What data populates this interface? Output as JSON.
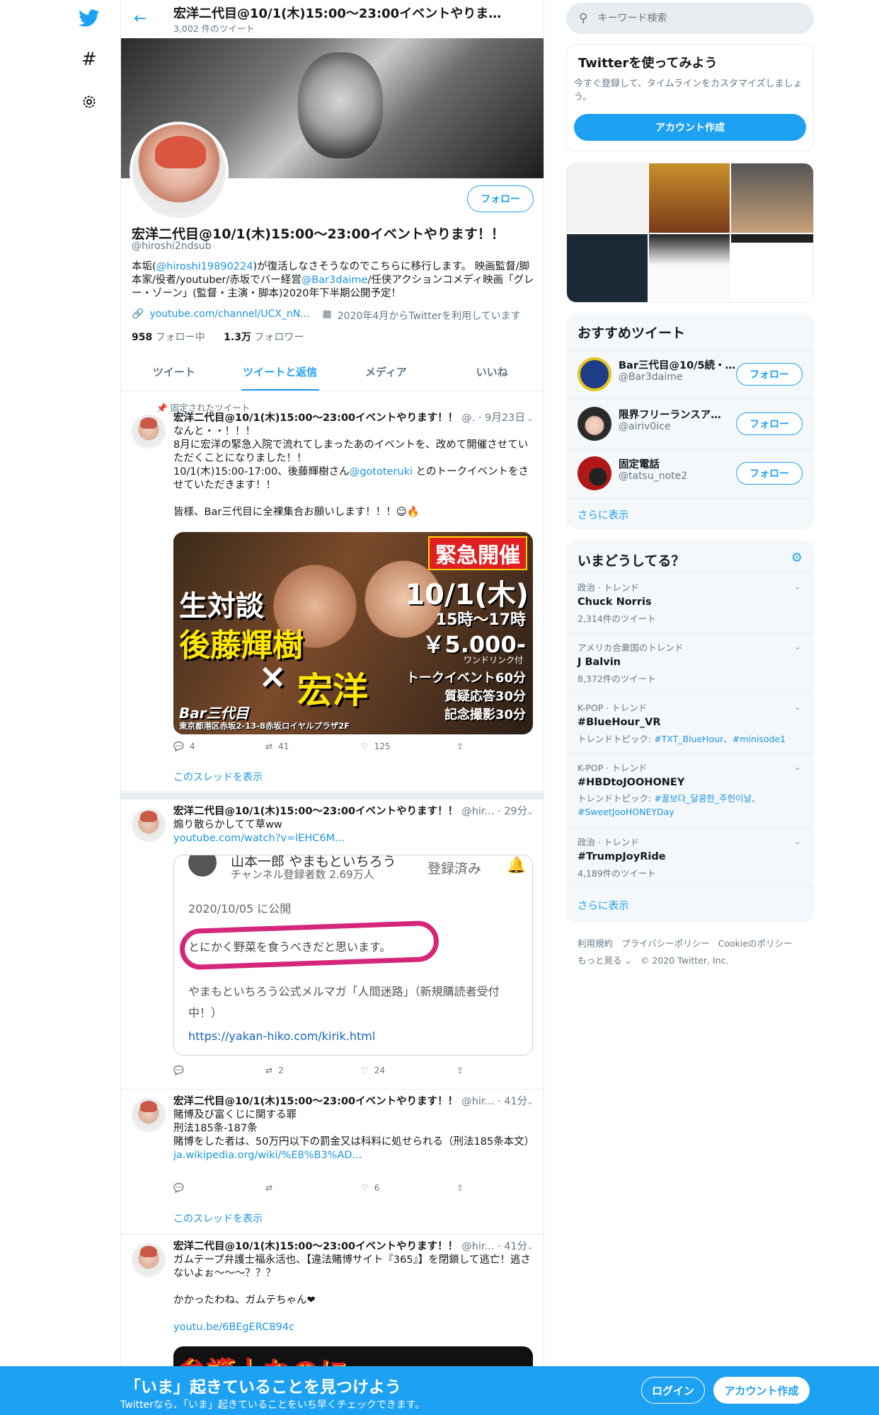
{
  "header": {
    "title": "宏洋二代目@10/1(木)15:00〜23:00イベントやりま…",
    "subtitle": "3,002 件のツイート"
  },
  "profile": {
    "name": "宏洋二代目@10/1(木)15:00〜23:00イベントやります！！",
    "handle": "@hiroshi2ndsub",
    "follow_label": "フォロー",
    "bio_1": "本垢(",
    "bio_link1": "@hiroshi19890224",
    "bio_2": ")が復活しなさそうなのでこちらに移行します。 映画監督/脚本家/役者/youtuber/赤坂でバー経営",
    "bio_link2": "@Bar3daime",
    "bio_3": "/任侠アクションコメディ映画「グレー・ゾーン」(監督・主演・脚本)2020年下半期公開予定！",
    "url": "youtube.com/channel/UCX_nN...",
    "joined": "2020年4月からTwitterを利用しています",
    "following_count": "958",
    "following_label": "フォロー中",
    "followers_count": "1.3万",
    "followers_label": "フォロワー"
  },
  "tabs": [
    "ツイート",
    "ツイートと返信",
    "メディア",
    "いいね"
  ],
  "tweets": [
    {
      "pinned": "固定されたツイート",
      "name": "宏洋二代目@10/1(木)15:00〜23:00イベントやります！！",
      "meta": "@. · 9月23日",
      "l1": "なんと・・！！！",
      "l2": "8月に宏洋の緊急入院で流れてしまったあのイベントを、改めて開催させていただくことになりました！！",
      "l3a": "10/1(木)15:00-17:00、後藤輝樹さん",
      "l3link": "@gototeruki",
      "l3b": " とのトークイベントをさせていただきます！！",
      "l4": "皆様、Bar三代目に全裸集合お願いします！！！☺🔥",
      "img": {
        "badge": "緊急開催",
        "date": "10/1(木)",
        "time": "15時〜17時",
        "price": "￥5.000-",
        "price_sub": "ワンドリンク付",
        "big1": "生対談",
        "big2": "後藤輝樹",
        "cross": "×",
        "big3": "宏洋",
        "r1": "トークイベント60分",
        "r2": "質疑応答30分",
        "r3": "記念撮影30分",
        "bar": "Bar三代目",
        "addr": "東京都港区赤坂2-13-8赤坂ロイヤルプラザ2F"
      },
      "replies": "",
      "retweets": "41",
      "likes": "125",
      "replies_n": "4",
      "thread": "このスレッドを表示"
    },
    {
      "name": "宏洋二代目@10/1(木)15:00〜23:00イベントやります！！",
      "meta": "@hir... · 29分",
      "l1": "煽り散らかしてて草ww",
      "link": "youtube.com/watch?v=lEHC6M...",
      "card": {
        "channel": "山本一郎 やまもといちろう",
        "subs": "チャンネル登録者数 2.69万人",
        "registered": "登録済み",
        "date": "2020/10/05 に公開",
        "quote": "とにかく野菜を食うべきだと思います。",
        "mag": "やまもといちろう公式メルマガ「人間迷路」（新規購読者受付中！）",
        "url": "https://yakan-hiko.com/kirik.html"
      },
      "retweets": "2",
      "likes": "24"
    },
    {
      "name": "宏洋二代目@10/1(木)15:00〜23:00イベントやります！！",
      "meta": "@hir... · 41分",
      "l1": "賭博及び富くじに関する罪",
      "l2": "刑法185条-187条",
      "l3": "賭博をした者は、50万円以下の罰金又は科料に処せられる（刑法185条本文）",
      "link": "ja.wikipedia.org/wiki/%E8%B3%AD...",
      "likes": "6",
      "thread": "このスレッドを表示"
    },
    {
      "name": "宏洋二代目@10/1(木)15:00〜23:00イベントやります！！",
      "meta": "@hir... · 41分",
      "l1": "ガムテープ弁護士福永活也、【違法賭博サイト『365』】を閉鎖して逃亡！逃さないよぉ〜〜〜？？？",
      "l2": "かかったわね、ガムテちゃん❤",
      "link": "youtu.be/6BEgERC894c",
      "img_text": "弁護士なのに"
    }
  ],
  "search": {
    "placeholder": "キーワード検索"
  },
  "signup": {
    "title": "Twitterを使ってみよう",
    "desc": "今すぐ登録して、タイムラインをカスタマイズしましょう。",
    "button": "アカウント作成"
  },
  "recommend": {
    "title": "おすすめツイート",
    "users": [
      {
        "name": "Bar三代目@10/5続・…",
        "handle": "@Bar3daime",
        "color": "#e6c619"
      },
      {
        "name": "限界フリーランスア…",
        "handle": "@airiv0ice",
        "color": "#2a2a2a"
      },
      {
        "name": "固定電話",
        "handle": "@tatsu_note2",
        "color": "#b01818"
      }
    ],
    "follow": "フォロー",
    "more": "さらに表示"
  },
  "trends": {
    "title": "いまどうしてる？",
    "items": [
      {
        "cat": "政治 · トレンド",
        "topic": "Chuck Norris",
        "count": "2,314件のツイート"
      },
      {
        "cat": "アメリカ合衆国のトレンド",
        "topic": "J Balvin",
        "count": "8,372件のツイート"
      },
      {
        "cat": "K-POP · トレンド",
        "topic": "#BlueHour_VR",
        "count_pre": "トレンドトピック: ",
        "count_link": "#TXT_BlueHour、#minisode1"
      },
      {
        "cat": "K-POP · トレンド",
        "topic": "#HBDtoJOOHONEY",
        "count_pre": "トレンドトピック: ",
        "count_link": "#꿀보다_달콤한_주헌이날、#SweetJooHONEYDay"
      },
      {
        "cat": "政治 · トレンド",
        "topic": "#TrumpJoyRide",
        "count": "4,189件のツイート"
      }
    ],
    "more": "さらに表示"
  },
  "footer": {
    "l1": "利用規約",
    "l2": "プライバシーポリシー",
    "l3": "Cookieのポリシー",
    "l4": "もっと見る ⌄",
    "l5": "© 2020 Twitter, Inc."
  },
  "bottom": {
    "title": "「いま」起きていることを見つけよう",
    "sub": "Twitterなら、「いま」起きていることをいち早くチェックできます。",
    "login": "ログイン",
    "signup": "アカウント作成"
  },
  "colors": {
    "accent": "#1da1f2",
    "like_heart": "#e0245e"
  }
}
